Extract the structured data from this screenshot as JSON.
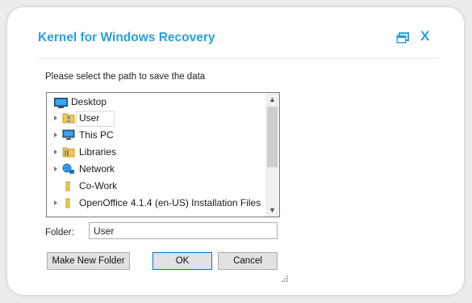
{
  "window": {
    "title": "Kernel for Windows Recovery",
    "close_glyph": "X",
    "accent_color": "#2a9fe0"
  },
  "prompt": "Please select the path to save the data",
  "tree": {
    "items": [
      {
        "label": "Desktop",
        "icon": "desktop-icon",
        "expander": false
      },
      {
        "label": "User",
        "icon": "user-folder-icon",
        "expander": true
      },
      {
        "label": "This PC",
        "icon": "computer-icon",
        "expander": true
      },
      {
        "label": "Libraries",
        "icon": "folder-icon",
        "expander": true
      },
      {
        "label": "Network",
        "icon": "network-icon",
        "expander": true
      },
      {
        "label": "Co-Work",
        "icon": "folder-icon",
        "expander": false
      },
      {
        "label": "OpenOffice 4.1.4 (en-US) Installation Files",
        "icon": "folder-icon",
        "expander": true
      }
    ],
    "selected": "User"
  },
  "folder": {
    "label": "Folder:",
    "value": "User"
  },
  "buttons": {
    "make_new_folder": "Make New Folder",
    "ok": "OK",
    "cancel": "Cancel"
  }
}
